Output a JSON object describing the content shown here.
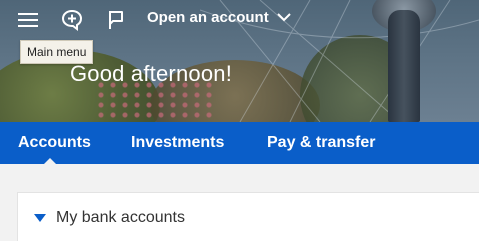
{
  "header": {
    "open_account_label": "Open an account",
    "tooltip": "Main menu",
    "greeting": "Good afternoon!"
  },
  "icons": {
    "menu": "menu-icon",
    "chat": "chat-plus-icon",
    "flag": "flag-icon",
    "chevron": "chevron-down-icon"
  },
  "nav": {
    "tabs": [
      {
        "label": "Accounts",
        "active": true
      },
      {
        "label": "Investments",
        "active": false
      },
      {
        "label": "Pay & transfer",
        "active": false
      }
    ]
  },
  "accounts_section": {
    "title": "My bank accounts",
    "expanded": true
  },
  "colors": {
    "nav_blue": "#0a5ec9",
    "background": "#f2f2f2",
    "text_white": "#ffffff"
  }
}
